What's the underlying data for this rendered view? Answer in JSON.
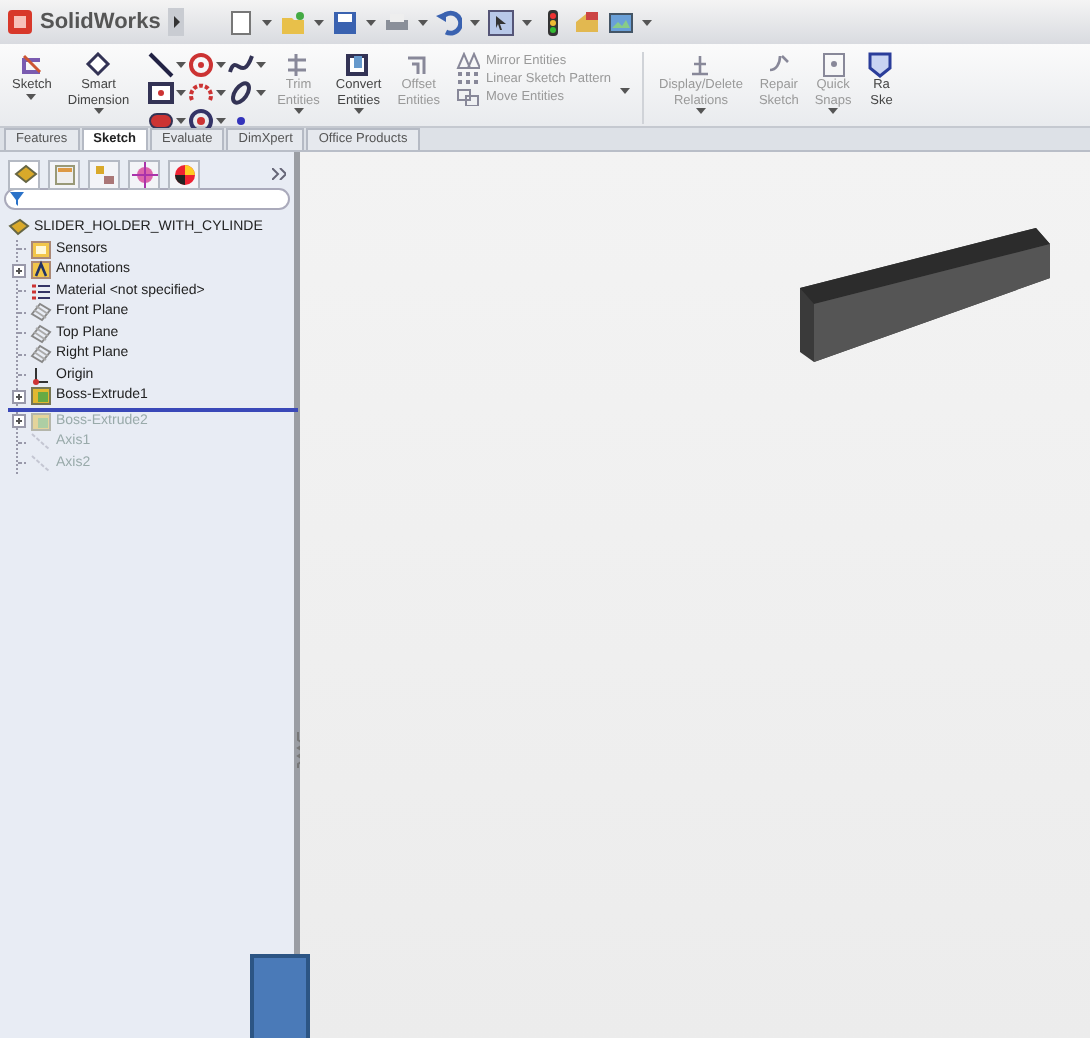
{
  "app": {
    "title": "SolidWorks"
  },
  "ribbon": {
    "left_buttons": [
      {
        "lines": [
          "Sketch"
        ],
        "disabled": false
      },
      {
        "lines": [
          "Smart",
          "Dimension"
        ],
        "disabled": false
      }
    ],
    "mid_buttons": [
      {
        "lines": [
          "Trim",
          "Entities"
        ],
        "disabled": true
      },
      {
        "lines": [
          "Convert",
          "Entities"
        ],
        "disabled": false
      },
      {
        "lines": [
          "Offset",
          "Entities"
        ],
        "disabled": true
      }
    ],
    "list": [
      {
        "label": "Mirror Entities",
        "disabled": true
      },
      {
        "label": "Linear Sketch Pattern",
        "disabled": true
      },
      {
        "label": "Move Entities",
        "disabled": true
      }
    ],
    "right_buttons": [
      {
        "lines": [
          "Display/Delete",
          "Relations"
        ],
        "disabled": true
      },
      {
        "lines": [
          "Repair",
          "Sketch"
        ],
        "disabled": true
      },
      {
        "lines": [
          "Quick",
          "Snaps"
        ],
        "disabled": true
      },
      {
        "lines": [
          "Ra",
          "Ske"
        ],
        "disabled": false
      }
    ]
  },
  "tabs": [
    {
      "label": "Features",
      "selected": false
    },
    {
      "label": "Sketch",
      "selected": true
    },
    {
      "label": "Evaluate",
      "selected": false
    },
    {
      "label": "DimXpert",
      "selected": false
    },
    {
      "label": "Office Products",
      "selected": false
    }
  ],
  "tree": {
    "label": "SLIDER_HOLDER_WITH_CYLINDE",
    "children": [
      {
        "label": "Sensors",
        "kind": "folder",
        "expandable": false,
        "rolled_back": false
      },
      {
        "label": "Annotations",
        "kind": "annotation",
        "expandable": true,
        "rolled_back": false
      },
      {
        "label": "Material <not specified>",
        "kind": "material",
        "expandable": false,
        "rolled_back": false
      },
      {
        "label": "Front Plane",
        "kind": "plane",
        "expandable": false,
        "rolled_back": false
      },
      {
        "label": "Top Plane",
        "kind": "plane",
        "expandable": false,
        "rolled_back": false
      },
      {
        "label": "Right Plane",
        "kind": "plane",
        "expandable": false,
        "rolled_back": false
      },
      {
        "label": "Origin",
        "kind": "origin",
        "expandable": false,
        "rolled_back": false
      },
      {
        "label": "Boss-Extrude1",
        "kind": "feature",
        "expandable": true,
        "rolled_back": false
      },
      {
        "label": "Boss-Extrude2",
        "kind": "feature",
        "expandable": true,
        "rolled_back": true
      },
      {
        "label": "Axis1",
        "kind": "axis",
        "expandable": false,
        "rolled_back": true
      },
      {
        "label": "Axis2",
        "kind": "axis",
        "expandable": false,
        "rolled_back": true
      }
    ]
  }
}
